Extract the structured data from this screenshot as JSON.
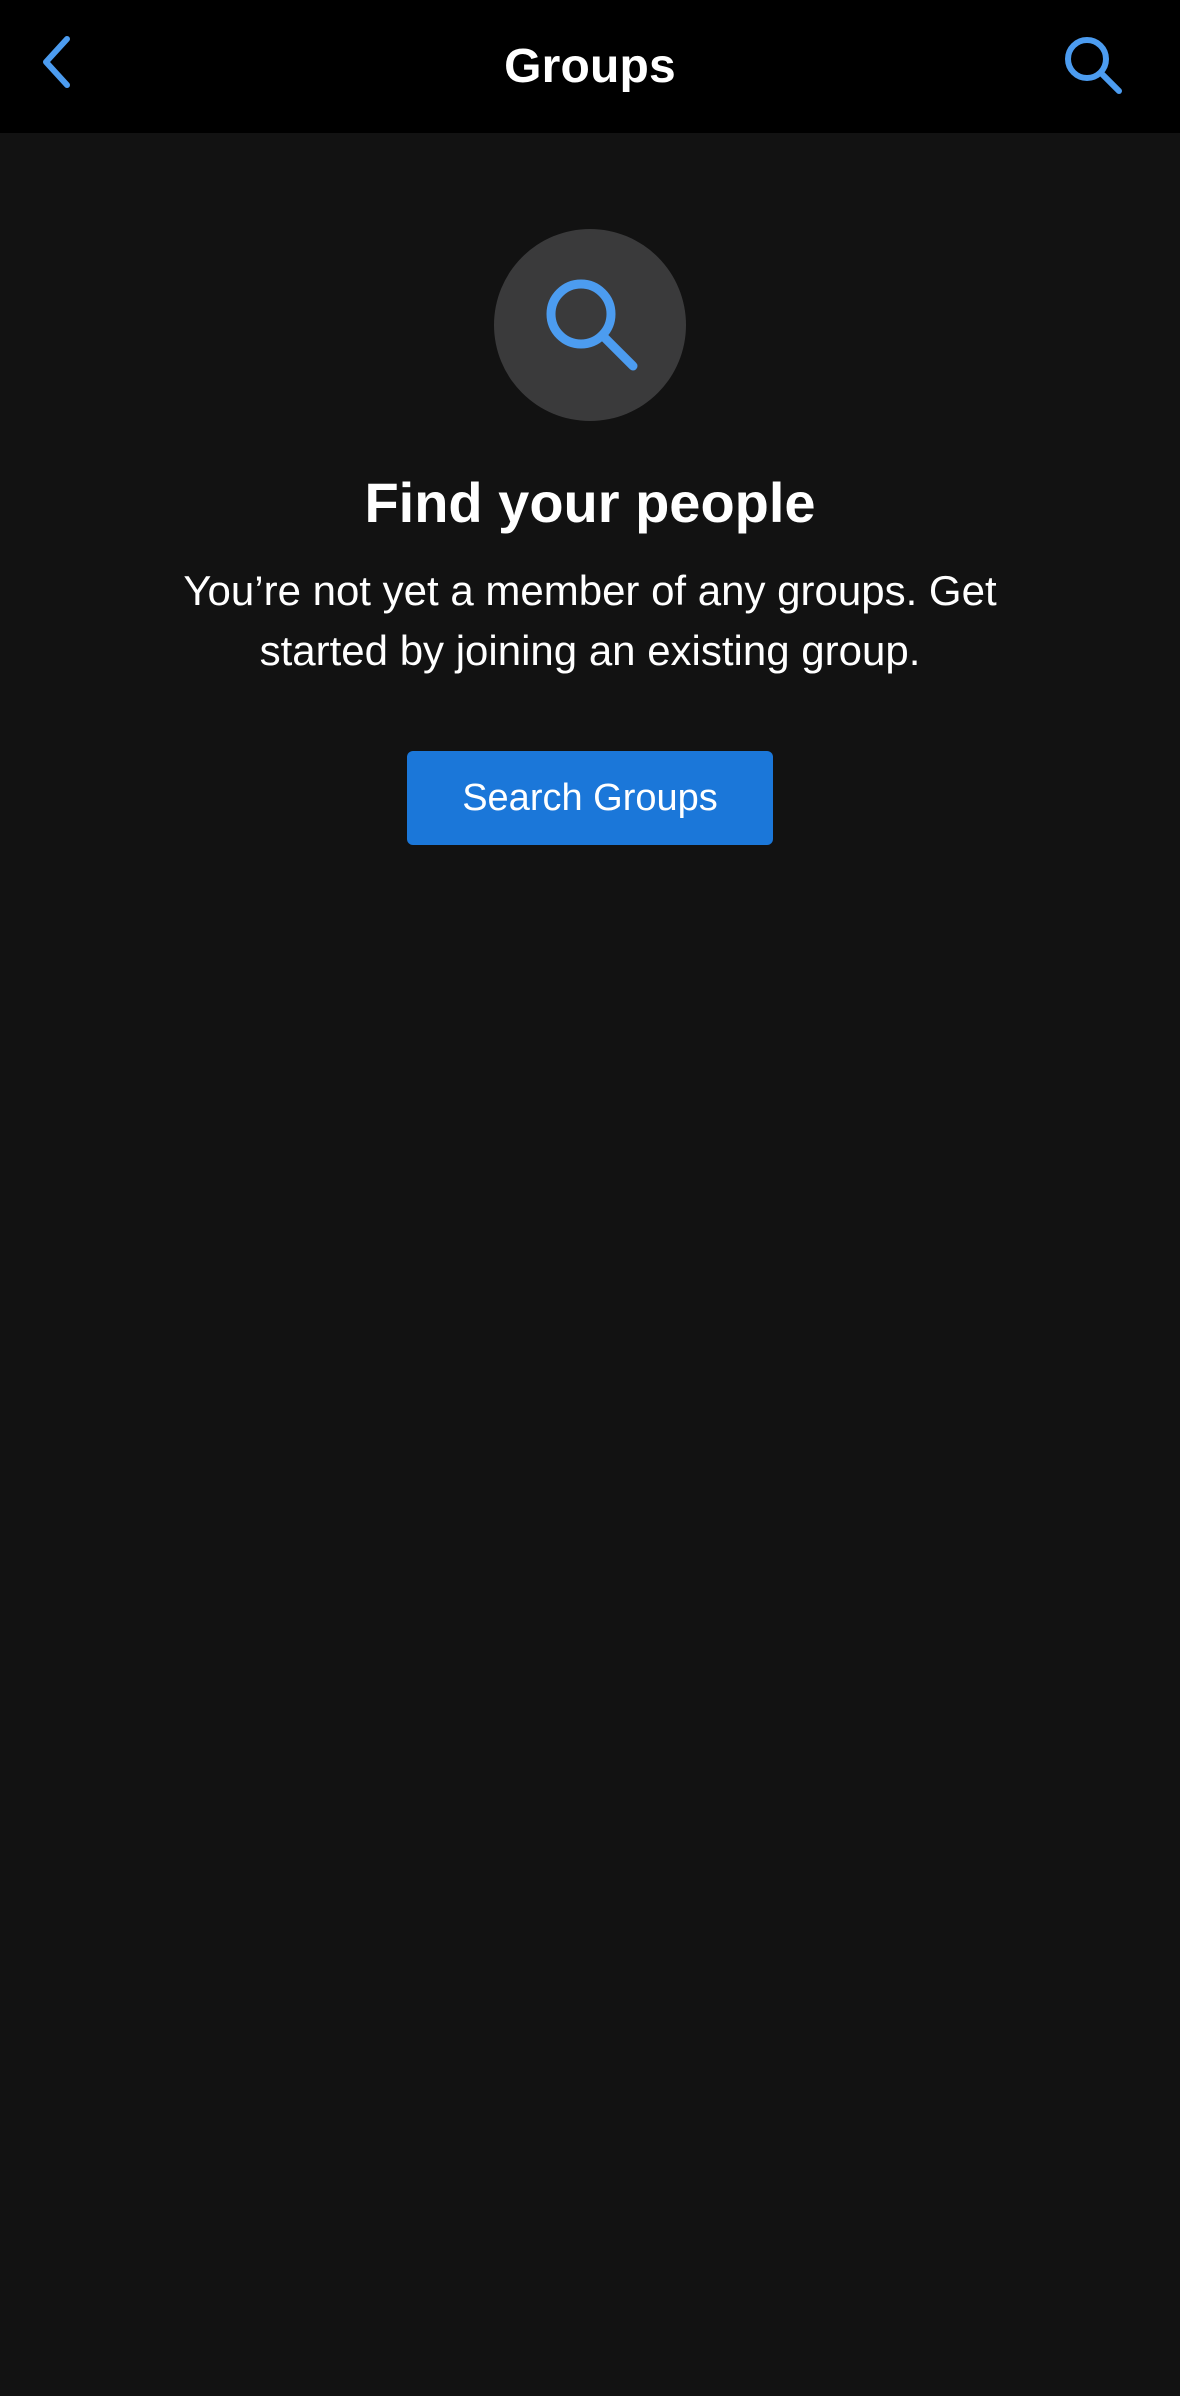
{
  "header": {
    "title": "Groups",
    "back_icon": "chevron-left-icon",
    "search_icon": "search-icon"
  },
  "empty_state": {
    "icon": "search-icon",
    "headline": "Find your people",
    "description": "You’re not yet a member of any groups. Get started by joining an existing group.",
    "button_label": "Search Groups"
  },
  "colors": {
    "accent": "#4c9cf0",
    "button": "#1b77d9",
    "nav_background": "#000000",
    "page_background": "#121212",
    "icon_circle": "#3a3a3b"
  }
}
